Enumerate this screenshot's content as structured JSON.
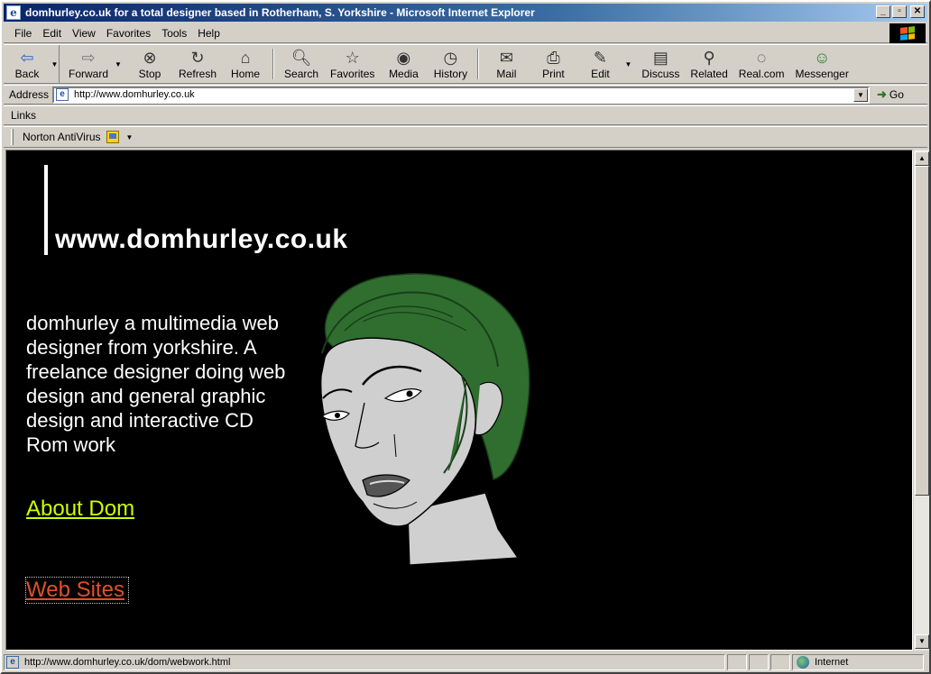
{
  "window": {
    "title": "domhurley.co.uk for a total designer based in Rotherham, S. Yorkshire - Microsoft Internet Explorer"
  },
  "menu": [
    "File",
    "Edit",
    "View",
    "Favorites",
    "Tools",
    "Help"
  ],
  "toolbar": {
    "back": "Back",
    "forward": "Forward",
    "stop": "Stop",
    "refresh": "Refresh",
    "home": "Home",
    "search": "Search",
    "favorites": "Favorites",
    "media": "Media",
    "history": "History",
    "mail": "Mail",
    "print": "Print",
    "edit": "Edit",
    "discuss": "Discuss",
    "related": "Related",
    "realcom": "Real.com",
    "messenger": "Messenger"
  },
  "address": {
    "label": "Address",
    "url": "http://www.domhurley.co.uk",
    "go": "Go"
  },
  "links_bar": {
    "label": "Links"
  },
  "norton_bar": {
    "label": "Norton AntiVirus"
  },
  "page": {
    "site_title": "www.domhurley.co.uk",
    "intro": "domhurley a multimedia web designer from yorkshire. A freelance designer doing web design and general graphic design and interactive CD Rom work",
    "about_link": "About Dom",
    "websites_link": "Web Sites",
    "colors": {
      "background": "#000000",
      "about_link": "#ccff00",
      "websites_link": "#e0502a",
      "hair": "#2f6e2f"
    }
  },
  "status": {
    "text": "http://www.domhurley.co.uk/dom/webwork.html",
    "zone": "Internet"
  }
}
